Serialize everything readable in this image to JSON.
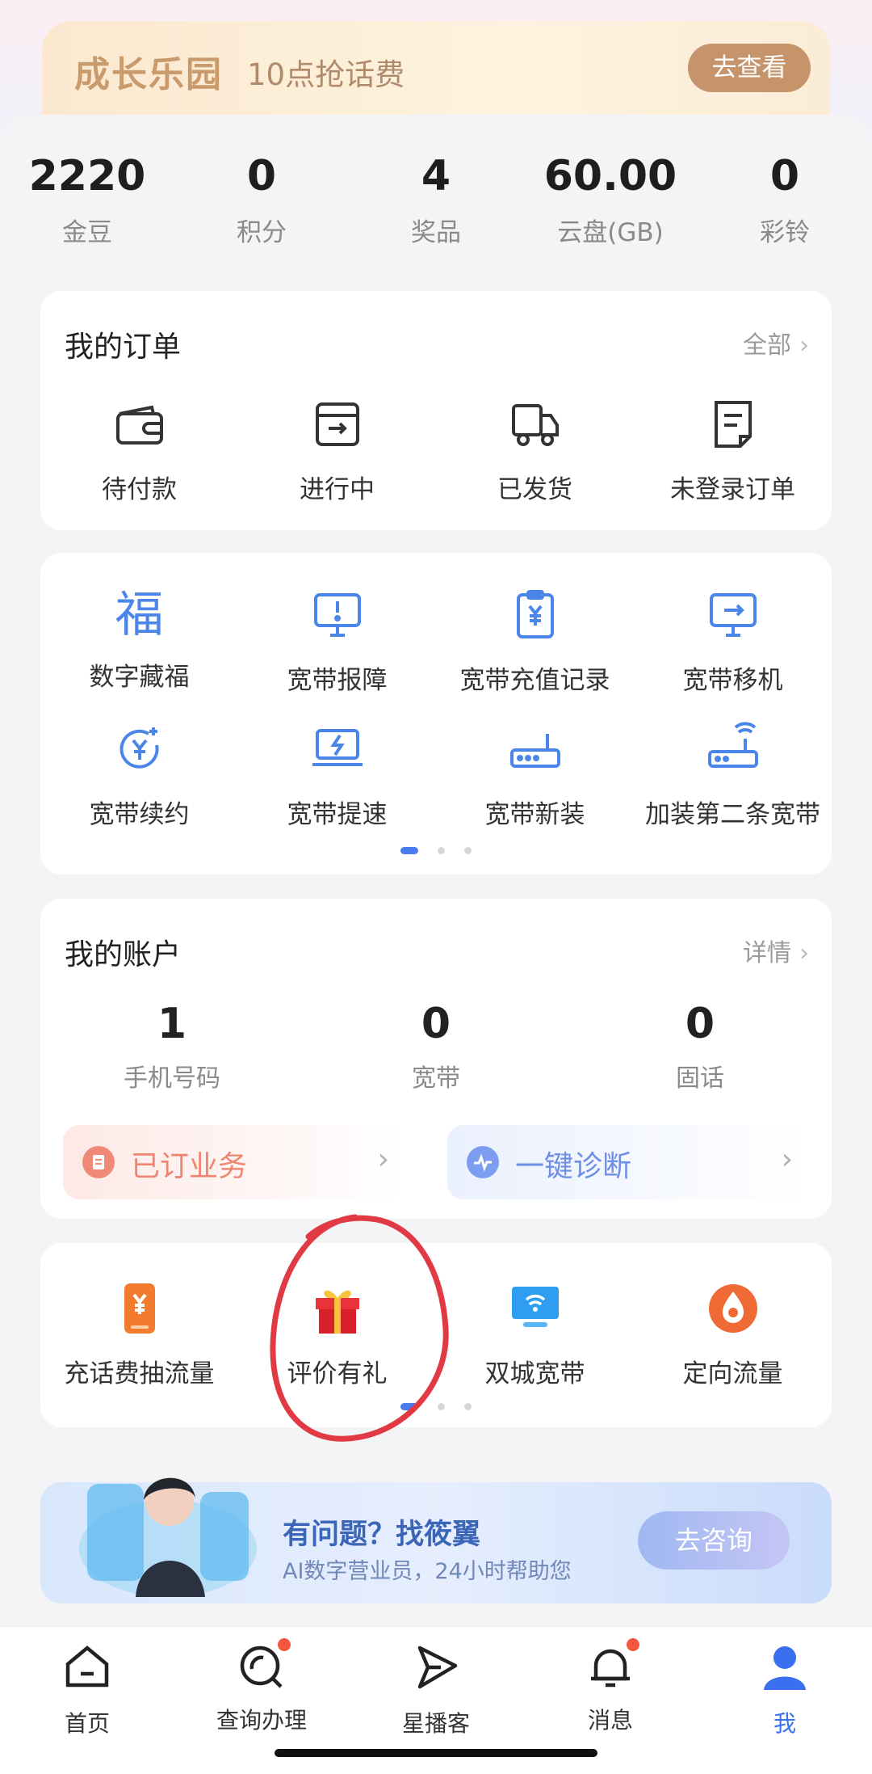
{
  "banner": {
    "brand": "成长乐园",
    "text": "10点抢话费",
    "button": "去查看"
  },
  "stats": [
    {
      "value": "2220",
      "label": "金豆"
    },
    {
      "value": "0",
      "label": "积分"
    },
    {
      "value": "4",
      "label": "奖品"
    },
    {
      "value": "60.00",
      "label": "云盘(GB)"
    },
    {
      "value": "0",
      "label": "彩铃"
    }
  ],
  "orders": {
    "title": "我的订单",
    "more": "全部",
    "items": [
      {
        "label": "待付款",
        "icon": "wallet-icon"
      },
      {
        "label": "进行中",
        "icon": "box-icon"
      },
      {
        "label": "已发货",
        "icon": "truck-icon"
      },
      {
        "label": "未登录订单",
        "icon": "document-icon"
      }
    ]
  },
  "services": {
    "items": [
      {
        "label": "数字藏福",
        "icon": "fu-icon"
      },
      {
        "label": "宽带报障",
        "icon": "monitor-alert-icon"
      },
      {
        "label": "宽带充值记录",
        "icon": "clipboard-yuan-icon"
      },
      {
        "label": "宽带移机",
        "icon": "monitor-move-icon"
      },
      {
        "label": "宽带续约",
        "icon": "yuan-renew-icon"
      },
      {
        "label": "宽带提速",
        "icon": "laptop-bolt-icon"
      },
      {
        "label": "宽带新装",
        "icon": "router-icon"
      },
      {
        "label": "加装第二条宽带",
        "icon": "router-wifi-icon"
      }
    ]
  },
  "account": {
    "title": "我的账户",
    "more": "详情",
    "items": [
      {
        "value": "1",
        "label": "手机号码"
      },
      {
        "value": "0",
        "label": "宽带"
      },
      {
        "value": "0",
        "label": "固话"
      }
    ],
    "pills": [
      {
        "label": "已订业务",
        "icon": "subscription-icon"
      },
      {
        "label": "一键诊断",
        "icon": "diagnose-icon"
      }
    ]
  },
  "activities": {
    "items": [
      {
        "label": "充话费抽流量",
        "icon": "phone-yuan-icon"
      },
      {
        "label": "评价有礼",
        "icon": "gift-icon"
      },
      {
        "label": "双城宽带",
        "icon": "wifi-screen-icon"
      },
      {
        "label": "定向流量",
        "icon": "flow-drop-icon"
      }
    ]
  },
  "promo": {
    "title": "有问题？找筱翼",
    "subtitle": "AI数字营业员，24小时帮助您",
    "button": "去咨询"
  },
  "tabbar": [
    {
      "label": "首页",
      "icon": "home-icon",
      "badge": false
    },
    {
      "label": "查询办理",
      "icon": "search-icon",
      "badge": true
    },
    {
      "label": "星播客",
      "icon": "play-icon",
      "badge": false
    },
    {
      "label": "消息",
      "icon": "bell-icon",
      "badge": true
    },
    {
      "label": "我",
      "icon": "user-icon",
      "badge": false,
      "active": true
    }
  ],
  "colors": {
    "accent": "#3a6ff0",
    "orange": "#e06a3b",
    "red": "#e8333b"
  }
}
